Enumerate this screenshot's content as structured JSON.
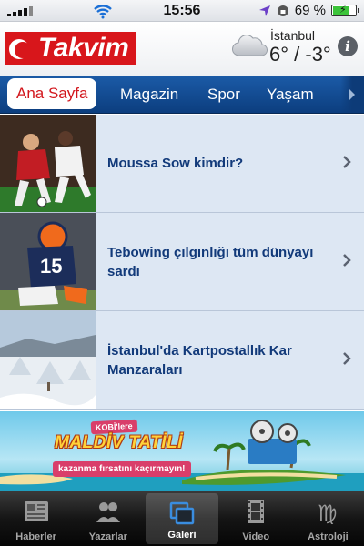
{
  "status_bar": {
    "time": "15:56",
    "battery_percent": "69 %",
    "battery_level": 0.69
  },
  "header": {
    "logo_text": "Takvim",
    "weather": {
      "city": "İstanbul",
      "temperature": "6° / -3°",
      "icon": "cloud-icon"
    },
    "info_icon": "info-icon"
  },
  "nav": {
    "tabs": [
      {
        "label": "Ana Sayfa",
        "active": true
      },
      {
        "label": "Magazin",
        "active": false
      },
      {
        "label": "Spor",
        "active": false
      },
      {
        "label": "Yaşam",
        "active": false
      }
    ],
    "more_icon": "chevron-right-icon"
  },
  "articles": [
    {
      "title": "Moussa Sow kimdir?",
      "thumb_icon": "soccer-photo"
    },
    {
      "title": "Tebowing çılgınlığı tüm dünyayı sardı",
      "thumb_icon": "football-photo"
    },
    {
      "title": "İstanbul'da Kartpostallık Kar Manzaraları",
      "thumb_icon": "snow-photo"
    }
  ],
  "banner": {
    "line1": "KOBİ'lere",
    "line2": "MALDİV TATİLİ",
    "line3": "kazanma fırsatını kaçırmayın!"
  },
  "tab_bar": {
    "items": [
      {
        "label": "Haberler",
        "icon": "newspaper-icon",
        "active": false
      },
      {
        "label": "Yazarlar",
        "icon": "people-icon",
        "active": false
      },
      {
        "label": "Galeri",
        "icon": "gallery-icon",
        "active": true
      },
      {
        "label": "Video",
        "icon": "film-icon",
        "active": false
      },
      {
        "label": "Astroloji",
        "icon": "zodiac-icon",
        "active": false
      }
    ]
  },
  "colors": {
    "brand_red": "#d8161b",
    "nav_blue": "#1b5aa6",
    "title_blue": "#123a7a",
    "row_bg": "#dde7f3"
  }
}
